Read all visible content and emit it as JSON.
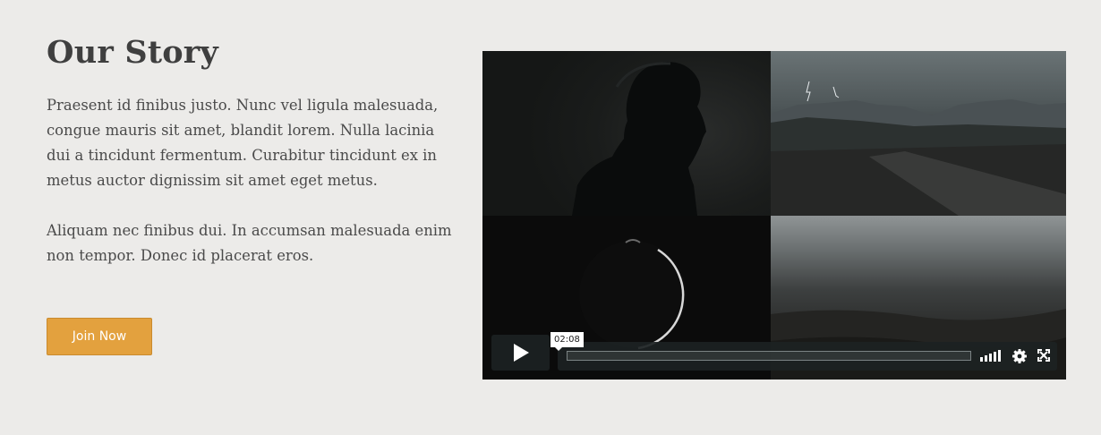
{
  "story": {
    "title": "Our Story",
    "paragraphs": [
      "Praesent id finibus justo. Nunc vel ligula malesuada, congue mauris sit amet, blandit lorem. Nulla lacinia dui a tincidunt fermentum. Curabitur tincidunt ex in metus auctor dignissim sit amet eget metus.",
      "Aliquam nec finibus dui. In accumsan malesuada enim non tempor. Donec id placerat eros."
    ],
    "cta_label": "Join Now"
  },
  "video": {
    "duration_label": "02:08",
    "progress_fraction": 0,
    "icons": [
      "play-icon",
      "volume-icon",
      "settings-icon",
      "fullscreen-icon"
    ]
  },
  "colors": {
    "background": "#ecebe9",
    "heading": "#3f3f3f",
    "body_text": "#4a4a4a",
    "accent": "#e3a13e"
  }
}
